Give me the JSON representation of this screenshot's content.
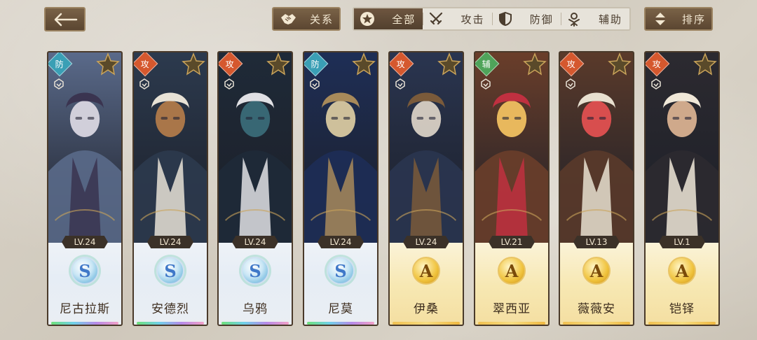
{
  "header": {
    "back_label": "",
    "relation_label": "关系",
    "sort_label": "排序",
    "filters": [
      {
        "label": "全部",
        "icon": "star-circle-icon",
        "active": true
      },
      {
        "label": "攻击",
        "icon": "crossed-swords-icon",
        "active": false
      },
      {
        "label": "防御",
        "icon": "shield-icon",
        "active": false
      },
      {
        "label": "辅助",
        "icon": "support-icon",
        "active": false
      }
    ]
  },
  "cards": [
    {
      "name": "尼古拉斯",
      "level": "LV.24",
      "rank": "S",
      "type": "防",
      "type_key": "def",
      "palette": [
        "#5a6a8a",
        "#d9d6e0",
        "#3a3450"
      ]
    },
    {
      "name": "安德烈",
      "level": "LV.24",
      "rank": "S",
      "type": "攻",
      "type_key": "atk",
      "palette": [
        "#2c3a4e",
        "#b07a4a",
        "#e8e2d6"
      ]
    },
    {
      "name": "乌鸦",
      "level": "LV.24",
      "rank": "S",
      "type": "攻",
      "type_key": "atk",
      "palette": [
        "#1f2a38",
        "#3a6a78",
        "#e0e0e4"
      ]
    },
    {
      "name": "尼莫",
      "level": "LV.24",
      "rank": "S",
      "type": "防",
      "type_key": "def",
      "palette": [
        "#1e2e56",
        "#d8c8a0",
        "#a88a5a"
      ]
    },
    {
      "name": "伊桑",
      "level": "LV.24",
      "rank": "A",
      "type": "攻",
      "type_key": "atk",
      "palette": [
        "#2a3550",
        "#d8d0c4",
        "#7a5a3a"
      ]
    },
    {
      "name": "翠西亚",
      "level": "LV.21",
      "rank": "A",
      "type": "辅",
      "type_key": "sup",
      "palette": [
        "#6a3e2a",
        "#f0c060",
        "#c03040"
      ]
    },
    {
      "name": "薇薇安",
      "level": "LV.13",
      "rank": "A",
      "type": "攻",
      "type_key": "atk",
      "palette": [
        "#5a3a2a",
        "#e05050",
        "#e8e0d0"
      ]
    },
    {
      "name": "铠铎",
      "level": "LV.1",
      "rank": "A",
      "type": "攻",
      "type_key": "atk",
      "palette": [
        "#2c2a30",
        "#d8b090",
        "#f0e8d8"
      ]
    }
  ],
  "colors": {
    "panel_brown": "#5b4631",
    "attack": "#d5582e",
    "defense": "#3a9fb5",
    "support": "#4fa45a"
  }
}
